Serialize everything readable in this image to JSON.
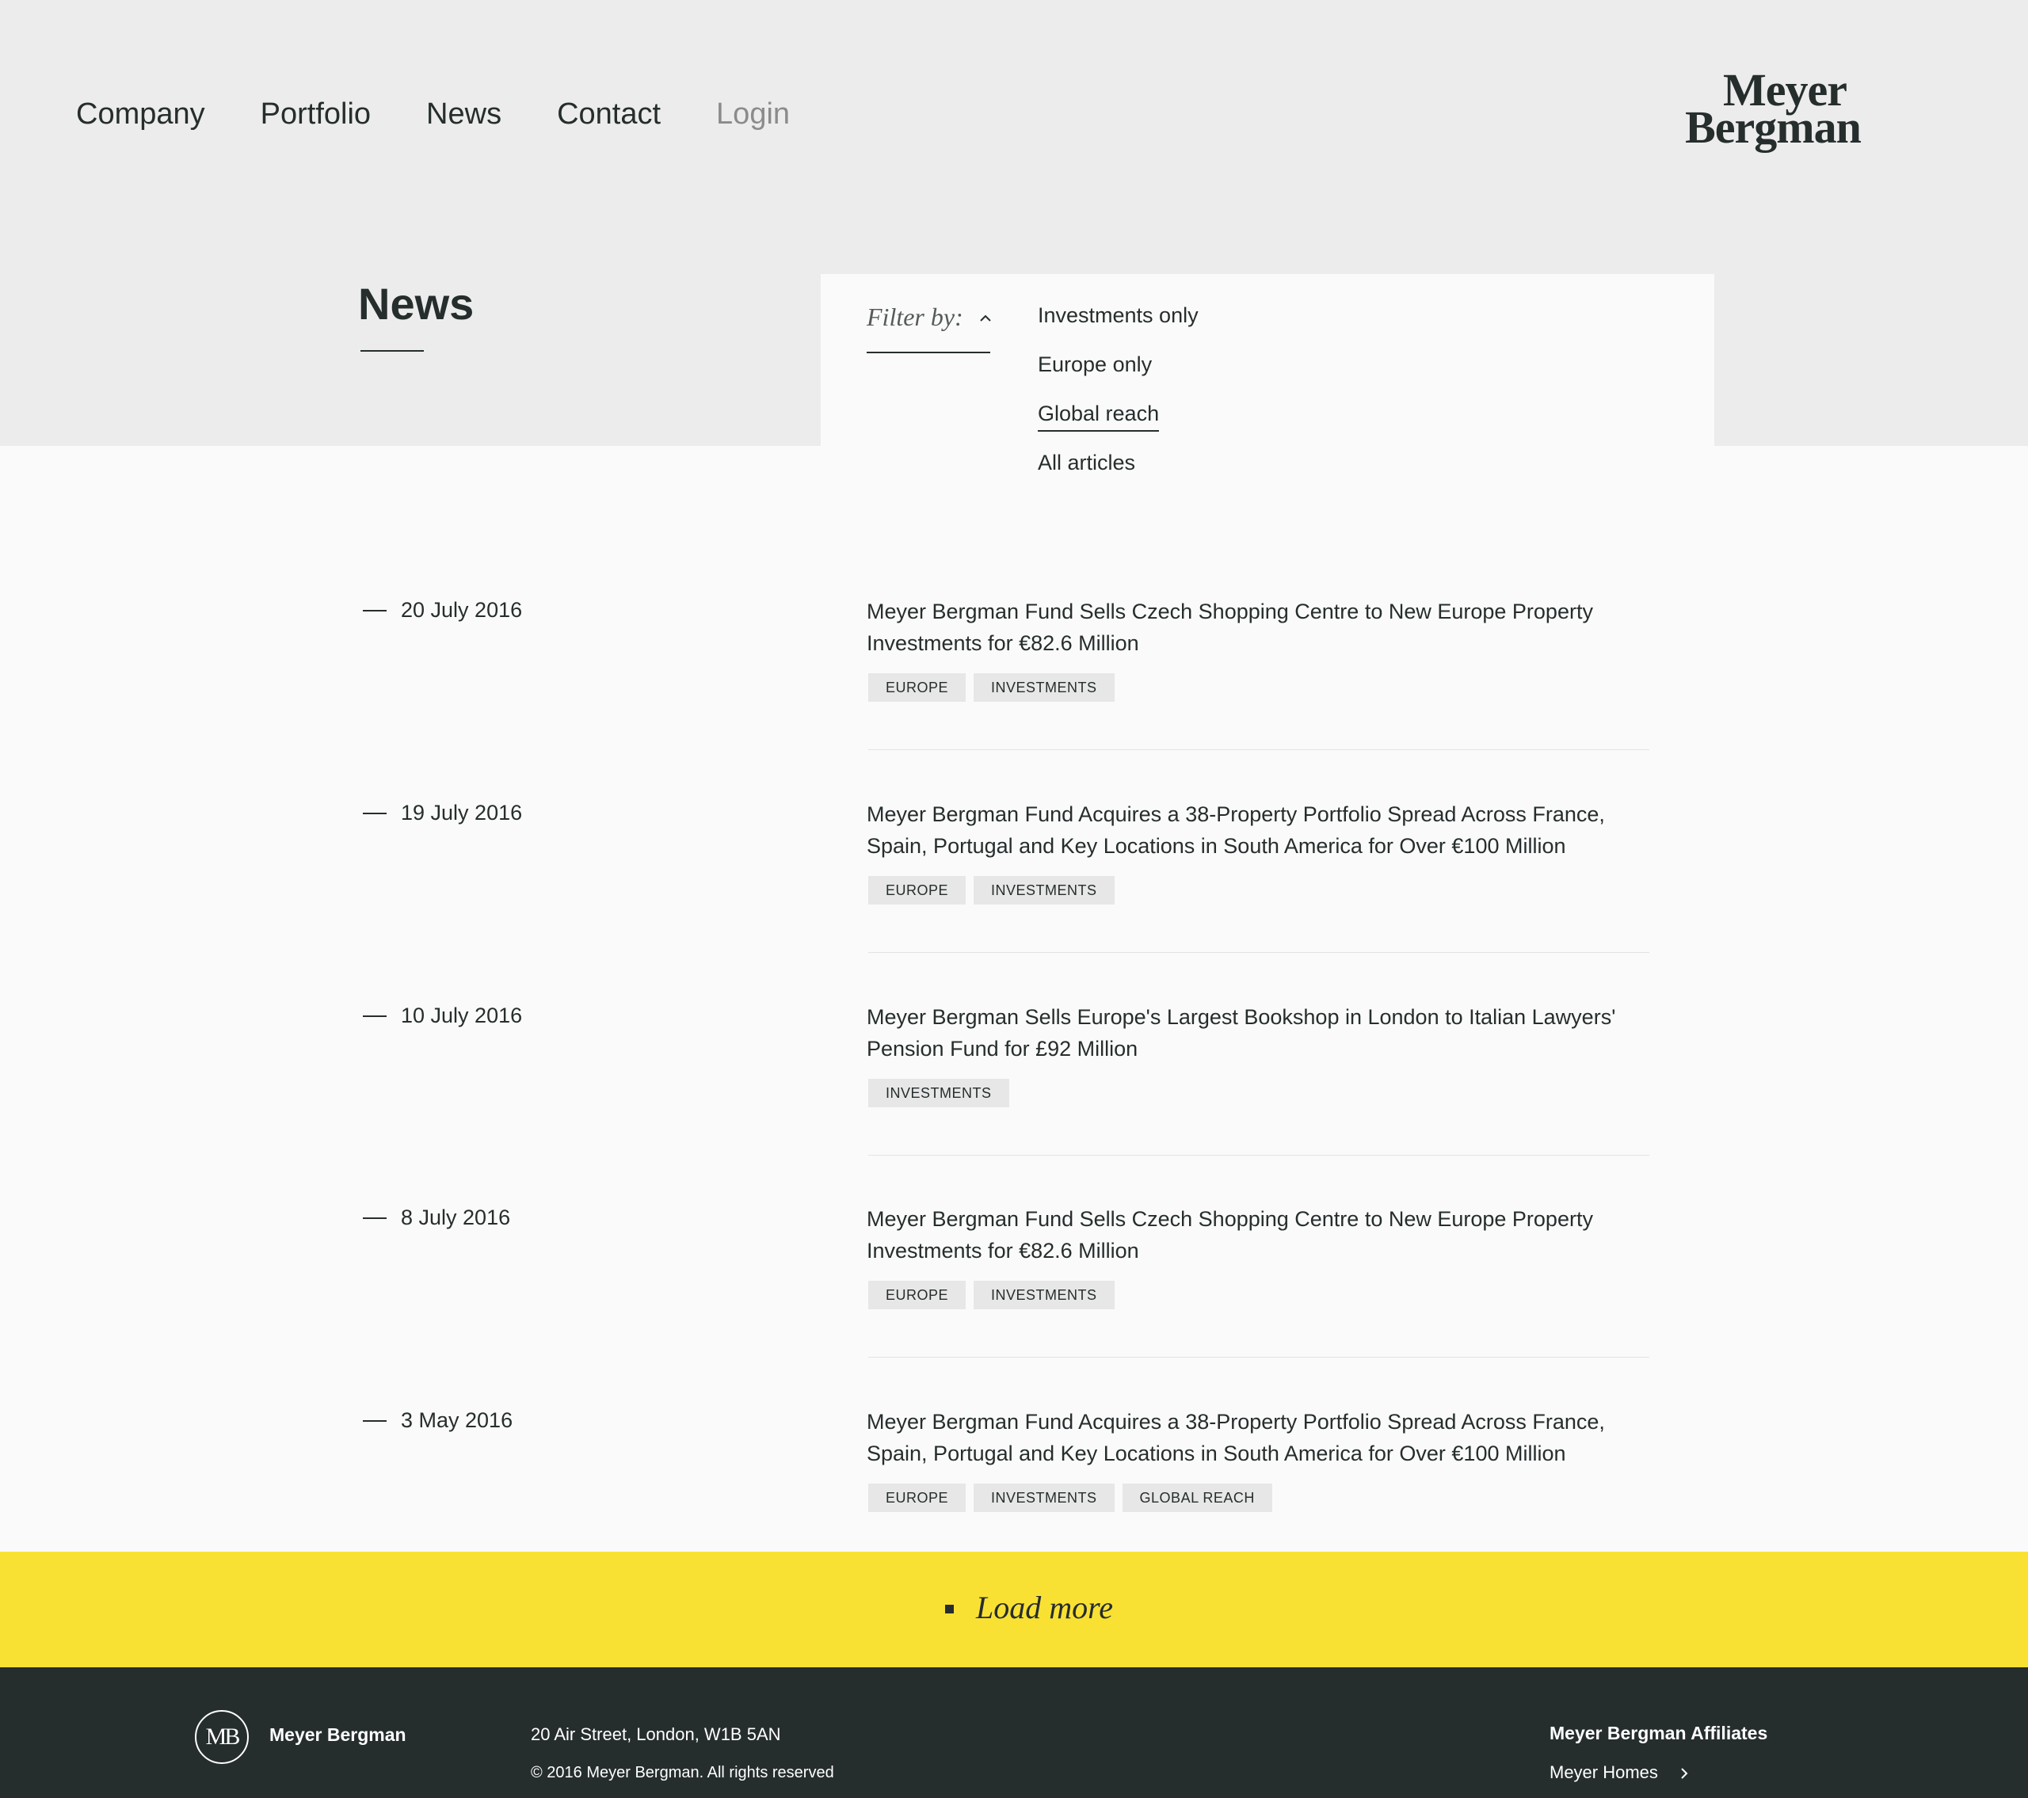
{
  "nav": {
    "items": [
      {
        "label": "Company"
      },
      {
        "label": "Portfolio"
      },
      {
        "label": "News"
      },
      {
        "label": "Contact"
      },
      {
        "label": "Login"
      }
    ]
  },
  "logo": {
    "line1": "Meyer",
    "line2": "Bergman"
  },
  "page": {
    "title": "News"
  },
  "filter": {
    "label": "Filter by:",
    "options": [
      {
        "label": "Investments only",
        "active": false
      },
      {
        "label": "Europe only",
        "active": false
      },
      {
        "label": "Global reach",
        "active": true
      },
      {
        "label": "All articles",
        "active": false
      }
    ]
  },
  "articles": [
    {
      "date": "20 July 2016",
      "title": "Meyer Bergman Fund Sells Czech Shopping Centre to New Europe Property Investments for €82.6 Million",
      "tags": [
        "EUROPE",
        "INVESTMENTS"
      ]
    },
    {
      "date": "19 July 2016",
      "title": "Meyer Bergman Fund Acquires a 38-Property Portfolio Spread Across France, Spain, Portugal and Key Locations in South America  for Over €100 Million",
      "tags": [
        "EUROPE",
        "INVESTMENTS"
      ]
    },
    {
      "date": "10 July 2016",
      "title": "Meyer Bergman Sells Europe's Largest Bookshop in London to Italian Lawyers' Pension Fund for £92 Million",
      "tags": [
        "INVESTMENTS"
      ]
    },
    {
      "date": "8 July 2016",
      "title": "Meyer Bergman Fund Sells Czech Shopping Centre to New Europe Property Investments for €82.6 Million",
      "tags": [
        "EUROPE",
        "INVESTMENTS"
      ]
    },
    {
      "date": "3 May 2016",
      "title": "Meyer Bergman Fund Acquires a 38-Property Portfolio Spread Across France, Spain, Portugal and Key Locations in South America  for Over €100 Million",
      "tags": [
        "EUROPE",
        "INVESTMENTS",
        "GLOBAL REACH"
      ]
    }
  ],
  "load_more": {
    "label": "Load more"
  },
  "footer": {
    "monogram": "MB",
    "brand": "Meyer Bergman",
    "address": "20 Air Street, London, W1B 5AN",
    "copyright": "© 2016 Meyer Bergman. All rights reserved",
    "affiliates_title": "Meyer Bergman Affiliates",
    "affiliate_link": "Meyer Homes"
  },
  "colors": {
    "header_bg": "#ececec",
    "page_bg": "#fafafa",
    "accent_yellow": "#f9e134",
    "footer_bg": "#262d2d",
    "text": "#262d2d",
    "tag_bg": "#e7e7e7"
  }
}
